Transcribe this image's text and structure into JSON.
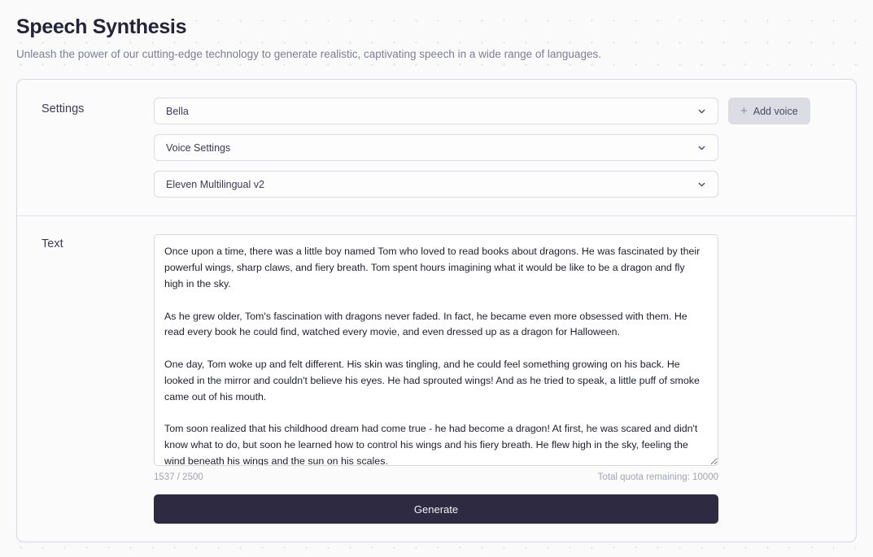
{
  "header": {
    "title": "Speech Synthesis",
    "subtitle": "Unleash the power of our cutting-edge technology to generate realistic, captivating speech in a wide range of languages."
  },
  "settings": {
    "label": "Settings",
    "voice_select": {
      "value": "Bella",
      "icon": "chevron-down-icon"
    },
    "voice_settings_select": {
      "value": "Voice Settings",
      "icon": "chevron-down-icon"
    },
    "model_select": {
      "value": "Eleven Multilingual v2",
      "icon": "chevron-down-icon"
    },
    "add_voice_button": {
      "label": "Add voice",
      "icon": "plus-icon"
    }
  },
  "text_section": {
    "label": "Text",
    "textarea": {
      "value": "Once upon a time, there was a little boy named Tom who loved to read books about dragons. He was fascinated by their powerful wings, sharp claws, and fiery breath. Tom spent hours imagining what it would be like to be a dragon and fly high in the sky.\n\nAs he grew older, Tom's fascination with dragons never faded. In fact, he became even more obsessed with them. He read every book he could find, watched every movie, and even dressed up as a dragon for Halloween.\n\nOne day, Tom woke up and felt different. His skin was tingling, and he could feel something growing on his back. He looked in the mirror and couldn't believe his eyes. He had sprouted wings! And as he tried to speak, a little puff of smoke came out of his mouth.\n\nTom soon realized that his childhood dream had come true - he had become a dragon! At first, he was scared and didn't know what to do, but soon he learned how to control his wings and his fiery breath. He flew high in the sky, feeling the wind beneath his wings and the sun on his scales.",
      "placeholder": ""
    },
    "char_counter": "1537 / 2500",
    "quota_text": "Total quota remaining: 10000",
    "generate_button": "Generate"
  },
  "colors": {
    "page_background": "#fafafa",
    "dot_pattern": "#dcdce4",
    "card_background": "#fbfbfc",
    "card_border": "#d7d8e2",
    "title_text": "#252339",
    "subtitle_text": "#7b7f96",
    "add_voice_background": "#dcdce5",
    "generate_background": "#2d2a42",
    "muted_text": "#a2a4b6"
  }
}
